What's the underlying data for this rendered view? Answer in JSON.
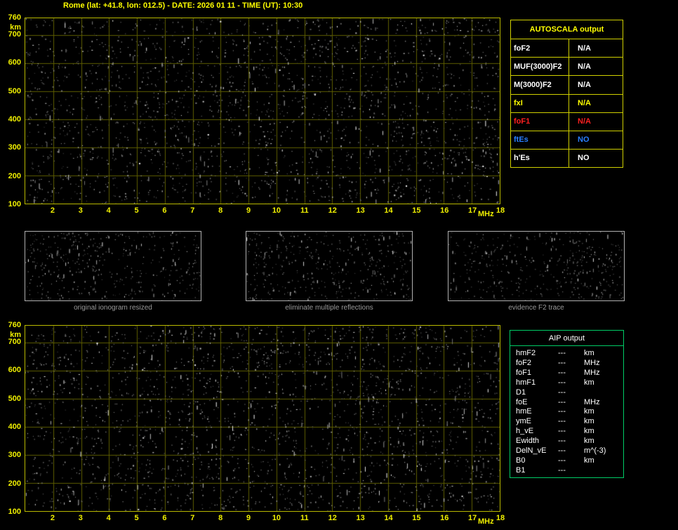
{
  "title": "Rome (lat: +41.8, lon: 012.5) - DATE: 2026 01 11 - TIME (UT): 10:30",
  "colors": {
    "background": "#000000",
    "title": "#ffff00",
    "grid": "#5e5e00",
    "plot_border": "#b8b800",
    "axis_label": "#f0f000",
    "autoscala_border": "#cfcf00",
    "aip_border": "#00cc66",
    "caption": "#999999",
    "white": "#ffffff",
    "yellow": "#ffff00",
    "red": "#ff2020",
    "blue": "#2a7fff"
  },
  "ionogram_top": {
    "y_unit": "km",
    "y_max_label": "760",
    "y_ticks": [
      "700",
      "600",
      "500",
      "400",
      "300",
      "200",
      "100"
    ],
    "x_ticks": [
      "2",
      "3",
      "4",
      "5",
      "6",
      "7",
      "8",
      "9",
      "10",
      "11",
      "12",
      "13",
      "14",
      "15",
      "16",
      "17",
      "18"
    ],
    "x_unit": "MHz",
    "x_range": [
      1,
      18
    ],
    "y_range": [
      100,
      760
    ]
  },
  "ionogram_bottom": {
    "y_unit": "km",
    "y_max_label": "760",
    "y_ticks": [
      "700",
      "600",
      "500",
      "400",
      "300",
      "200",
      "100"
    ],
    "x_ticks": [
      "2",
      "3",
      "4",
      "5",
      "6",
      "7",
      "8",
      "9",
      "10",
      "11",
      "12",
      "13",
      "14",
      "15",
      "16",
      "17",
      "18"
    ],
    "x_unit": "MHz",
    "x_range": [
      1,
      18
    ],
    "y_range": [
      100,
      760
    ]
  },
  "autoscala": {
    "title": "AUTOSCALA output",
    "rows": [
      {
        "label": "foF2",
        "value": "N/A",
        "color": "#ffffff"
      },
      {
        "label": "MUF(3000)F2",
        "value": "N/A",
        "color": "#ffffff"
      },
      {
        "label": "M(3000)F2",
        "value": "N/A",
        "color": "#ffffff"
      },
      {
        "label": "fxI",
        "value": "N/A",
        "color": "#ffff00"
      },
      {
        "label": "foF1",
        "value": "N/A",
        "color": "#ff2020"
      },
      {
        "label": "ftEs",
        "value": "NO",
        "color": "#2a7fff"
      },
      {
        "label": "h'Es",
        "value": "NO",
        "color": "#ffffff"
      }
    ]
  },
  "thumbnails": [
    {
      "caption": "original ionogram resized"
    },
    {
      "caption": "eliminate multiple reflections"
    },
    {
      "caption": "evidence F2 trace"
    }
  ],
  "aip": {
    "title": "AIP output",
    "rows": [
      {
        "label": "hmF2",
        "value": "---",
        "unit": "km"
      },
      {
        "label": "foF2",
        "value": "---",
        "unit": "MHz"
      },
      {
        "label": "foF1",
        "value": "---",
        "unit": "MHz"
      },
      {
        "label": "hmF1",
        "value": "---",
        "unit": "km"
      },
      {
        "label": "D1",
        "value": "---",
        "unit": ""
      },
      {
        "label": "foE",
        "value": "---",
        "unit": "MHz"
      },
      {
        "label": "hmE",
        "value": "---",
        "unit": "km"
      },
      {
        "label": "ymE",
        "value": "---",
        "unit": "km"
      },
      {
        "label": "h_vE",
        "value": "---",
        "unit": "km"
      },
      {
        "label": "Ewidth",
        "value": "---",
        "unit": "km"
      },
      {
        "label": "DelN_vE",
        "value": "---",
        "unit": "m^(-3)"
      },
      {
        "label": "B0",
        "value": "---",
        "unit": "km"
      },
      {
        "label": "B1",
        "value": "---",
        "unit": ""
      }
    ]
  }
}
